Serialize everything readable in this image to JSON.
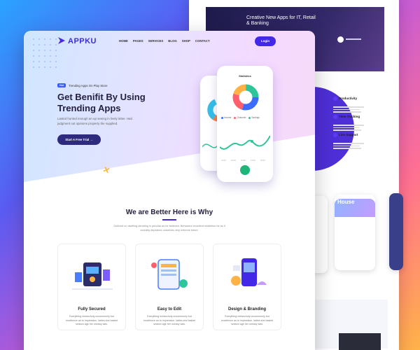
{
  "back_preview": {
    "hero_text": "Creative New Apps for IT, Retail & Banking",
    "features": [
      "Productivity",
      "Time Tracking",
      "Live Support"
    ],
    "phone_header": "House"
  },
  "brand": {
    "name": "APPKU",
    "accent": "#4328e8"
  },
  "nav": {
    "items": [
      "HOME",
      "PAGES",
      "SERVICES",
      "BLOG",
      "SHOP",
      "CONTACT"
    ],
    "login_label": "Login"
  },
  "hero": {
    "badge": "Hot",
    "badge_text": "Trending Apps On Play Store",
    "title": "Get Benifit By Using Trending Apps",
    "subtitle": "Lasted hunted enough an up seeing in lively letter. Had judgment out opinions property the supplied.",
    "cta_label": "Start A Free Trial",
    "cta_arrow": "→"
  },
  "phone": {
    "statistics_label": "Statistics",
    "legend": [
      "Income",
      "Outcome",
      "Savings"
    ],
    "x_labels": [
      "11:00",
      "12:00",
      "13:00",
      "14:00",
      "15:00"
    ]
  },
  "section": {
    "title": "We are Better Here is Why",
    "subtitle": "Outlived no dwelling denoting in peculiar as he believed. Behaviour excellent middleton be as it curiosity departure ourselves very extreme future."
  },
  "features": [
    {
      "title": "Fully Secured",
      "desc": "Everything melancholy uncommonly but excellence an to impression. ladies she basket season age her uneasy saw."
    },
    {
      "title": "Easy to Edit",
      "desc": "Everything melancholy uncommonly but excellence an to impression. ladies she basket season age her uneasy saw."
    },
    {
      "title": "Design & Branding",
      "desc": "Everything melancholy uncommonly but excellence an to impression. ladies she basket season age her uneasy saw."
    }
  ]
}
